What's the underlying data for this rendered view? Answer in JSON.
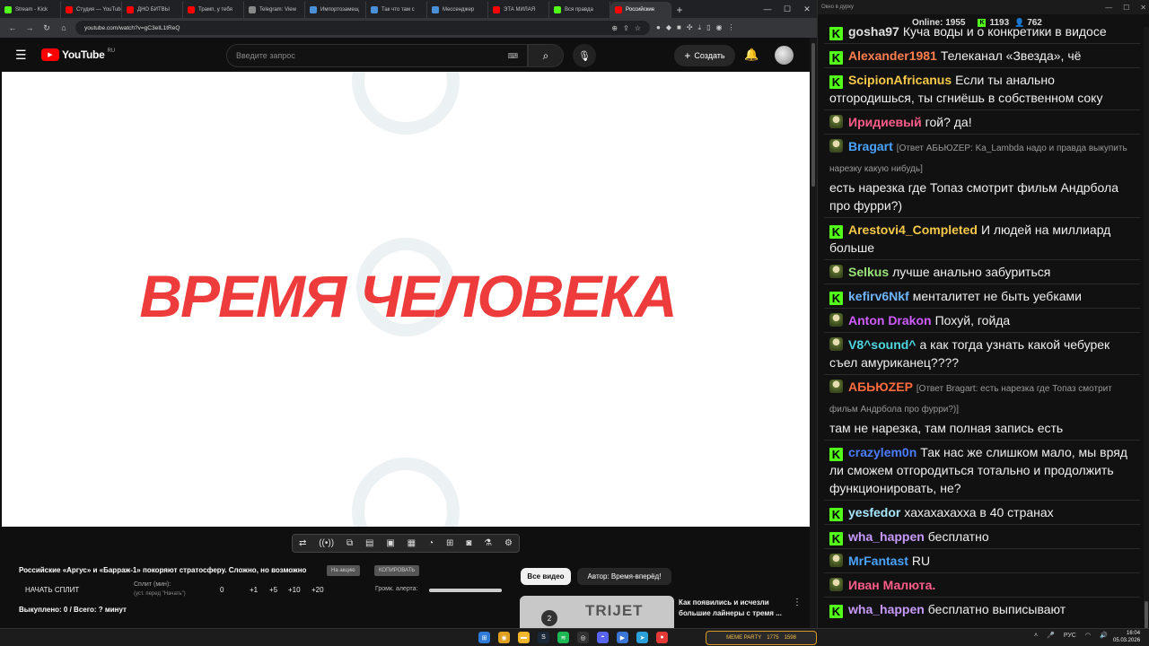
{
  "browser": {
    "tabs": [
      {
        "label": "Stream - Kick",
        "color": "#53fc18"
      },
      {
        "label": "Студия — YouTube",
        "color": "#ff0000"
      },
      {
        "label": "ДНО БИТВЫ",
        "color": "#ff0000"
      },
      {
        "label": "Трамп, у тебя",
        "color": "#ff0000"
      },
      {
        "label": "Telegram: View",
        "color": "#888888"
      },
      {
        "label": "Импортозамещ",
        "color": "#4a90d9"
      },
      {
        "label": "Так что там с",
        "color": "#4a90d9"
      },
      {
        "label": "Мессенджер",
        "color": "#4a90d9"
      },
      {
        "label": "ЭТА МИЛАЯ",
        "color": "#ff0000"
      },
      {
        "label": "Вся правда",
        "color": "#53fc18"
      },
      {
        "label": "Российские",
        "color": "#ff0000",
        "active": true
      }
    ],
    "url": "youtube.com/watch?v=gC3eIL1tReQ"
  },
  "youtube": {
    "logo_text": "YouTube",
    "region": "RU",
    "search_placeholder": "Введите запрос",
    "create_label": "Создать",
    "video_title_overlay": "ВРЕМЯ ЧЕЛОВЕКА"
  },
  "panel": {
    "title": "Российские «Аргус» и «Барраж-1» покоряют стратосферу. Сложно, но возможно",
    "pill1": "На акцию",
    "pill2": "КОПИРОВАТЬ",
    "start_split": "НАЧАТЬ СПЛИТ",
    "split_label": "Сплит (мин):",
    "split_sub": "(уст. перед \"Начать\")",
    "values": [
      "0",
      "+1",
      "+5",
      "+10",
      "+20"
    ],
    "alert_label": "Громк. алерта:",
    "alert_level": 1.0,
    "bought": "Выкуплено: 0 / Всего: ? минут",
    "all_videos": "Все видео",
    "author": "Автор: Время-вперёд!",
    "rec_title": "Как появились и исчезли большие лайнеры с тремя ...",
    "rec_thumb_text": "TRIJET",
    "rec_thumb_num": "2"
  },
  "chat": {
    "window_title": "Окно в дурку",
    "online_label": "Online:",
    "online": "1955",
    "k_count": "1193",
    "g_count": "762",
    "messages": [
      {
        "badge": "kick",
        "user": "gosha97",
        "color": "#e0e0e0",
        "text": "Куча воды и о конкретики в видосе"
      },
      {
        "badge": "kick",
        "user": "Alexander1981",
        "color": "#ff7f50",
        "text": "Телеканал «Звезда», чё"
      },
      {
        "badge": "kick",
        "user": "ScipionAfricanus",
        "color": "#f7c948",
        "text": "Если ты анально отгородишься, ты сгниёшь в собственном соку"
      },
      {
        "badge": "av",
        "user": "Иридиевый",
        "color": "#ff5c8a",
        "text": "гой? да!"
      },
      {
        "badge": "av",
        "user": "Bragart",
        "color": "#4aa3ff",
        "reply": "[Ответ АБЬЮZEP: Ka_Lambda надо и правда выкупить нарезку какую нибудь]",
        "text": "есть нарезка где Топаз смотрит фильм Андрбола про фурри?)"
      },
      {
        "badge": "kick",
        "user": "Arestovi4_Completed",
        "color": "#f7c948",
        "text": "И людей на миллиард больше"
      },
      {
        "badge": "av",
        "user": "Selkus",
        "color": "#9be37a",
        "text": "лучше анально забуриться"
      },
      {
        "badge": "kick",
        "user": "kefirv6Nkf",
        "color": "#6fb5ff",
        "text": "менталитет не быть уебками"
      },
      {
        "badge": "av",
        "user": "Anton Drakon",
        "color": "#d05cff",
        "text": "Похуй, гойда"
      },
      {
        "badge": "av",
        "user": "V8^sound^",
        "color": "#4dd7e0",
        "text": "а как тогда узнать какой чебурек съел амуриканец????"
      },
      {
        "badge": "av",
        "user": "АБЬЮZEP",
        "color": "#ff6b3d",
        "reply": "[Ответ Bragart: есть нарезка где Топаз смотрит фильм Андрбола про фурри?)]",
        "text": "там не нарезка, там полная запись есть"
      },
      {
        "badge": "kick",
        "user": "crazylem0n",
        "color": "#4a7dff",
        "text": "Так нас же слишком мало, мы вряд ли сможем отгородиться тотально и продолжить функционировать, не?"
      },
      {
        "badge": "kick",
        "user": "yesfedor",
        "color": "#a8e6ff",
        "text": "хахахахахха в 40 странах"
      },
      {
        "badge": "kick",
        "user": "wha_happen",
        "color": "#c79bff",
        "text": "бесплатно"
      },
      {
        "badge": "av",
        "user": "MrFantast",
        "color": "#4aa3ff",
        "text": "RU"
      },
      {
        "badge": "av",
        "user": "Иван Малюта.",
        "color": "#ff5c8a",
        "text": ""
      },
      {
        "badge": "kick",
        "user": "wha_happen",
        "color": "#c79bff",
        "text": "бесплатно выписывают"
      }
    ]
  },
  "taskbar": {
    "meme_label": "MEME PARTY",
    "meme_values": [
      "1775",
      "1598"
    ],
    "lang": "РУС",
    "time": "16:04",
    "date": "05.03.2026"
  }
}
